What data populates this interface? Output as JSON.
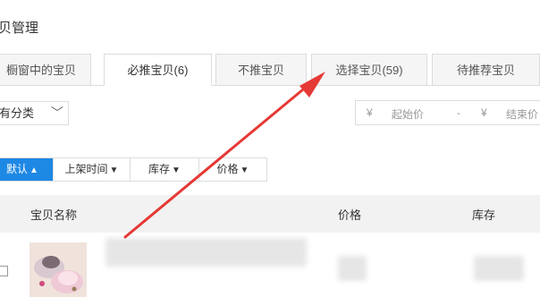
{
  "page": {
    "title": "贝管理"
  },
  "tabs": [
    {
      "label": "橱窗中的宝贝"
    },
    {
      "label": "必推宝贝(6)",
      "active": true
    },
    {
      "label": "不推宝贝"
    },
    {
      "label": "选择宝贝(59)"
    },
    {
      "label": "待推荐宝贝"
    }
  ],
  "filters": {
    "category": "有分类",
    "price_min_placeholder": "起始价",
    "price_max_placeholder": "结束价",
    "currency": "¥",
    "separator": "-"
  },
  "sort": [
    {
      "label": "默认",
      "active": true
    },
    {
      "label": "上架时间"
    },
    {
      "label": "库存"
    },
    {
      "label": "价格"
    }
  ],
  "table": {
    "columns": {
      "name": "宝贝名称",
      "price": "价格",
      "stock": "库存"
    }
  },
  "colors": {
    "accent": "#1e88e5",
    "annotation_arrow": "#e53935"
  }
}
